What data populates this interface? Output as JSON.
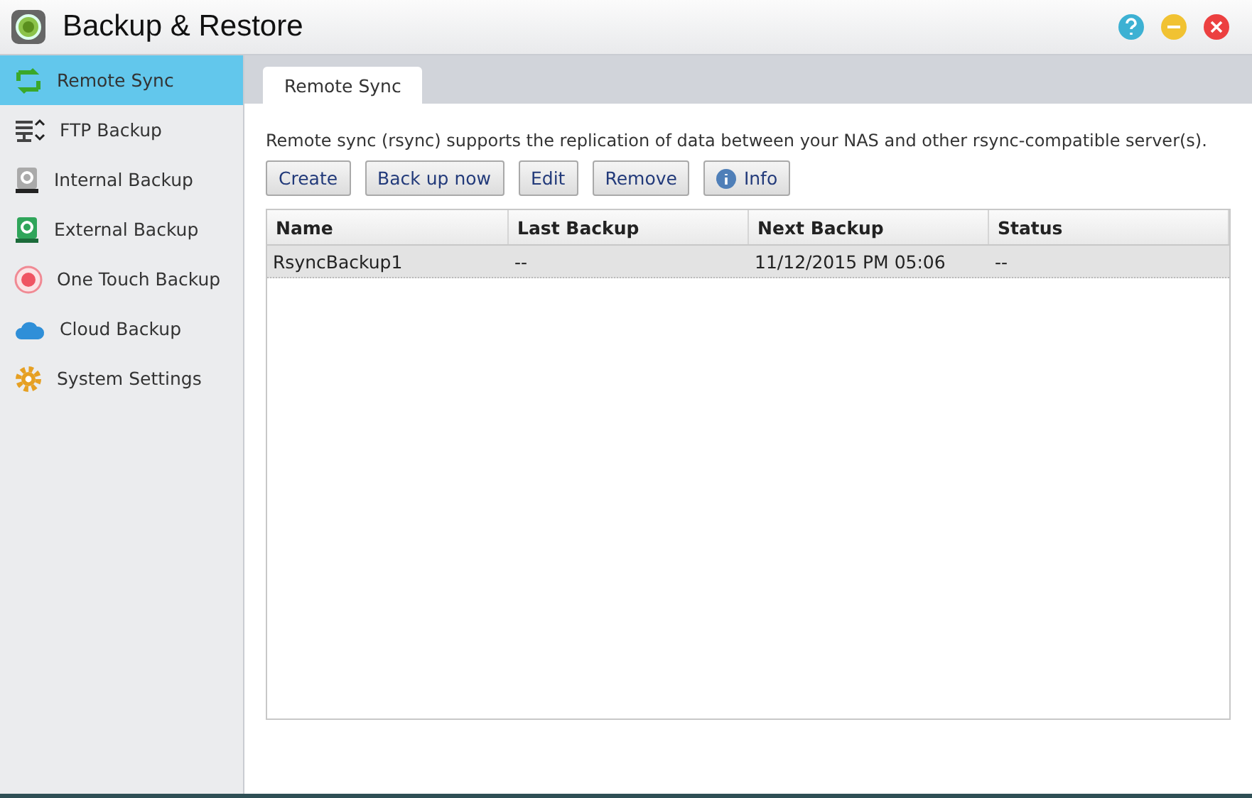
{
  "window": {
    "title": "Backup & Restore"
  },
  "sidebar": {
    "items": [
      {
        "label": "Remote Sync",
        "selected": true
      },
      {
        "label": "FTP Backup",
        "selected": false
      },
      {
        "label": "Internal Backup",
        "selected": false
      },
      {
        "label": "External Backup",
        "selected": false
      },
      {
        "label": "One Touch Backup",
        "selected": false
      },
      {
        "label": "Cloud Backup",
        "selected": false
      },
      {
        "label": "System Settings",
        "selected": false
      }
    ]
  },
  "tabs": [
    {
      "label": "Remote Sync",
      "selected": true
    }
  ],
  "description": "Remote sync (rsync) supports the replication of data between your NAS and other rsync-compatible server(s).",
  "buttons": [
    {
      "label": "Create"
    },
    {
      "label": "Back up now"
    },
    {
      "label": "Edit"
    },
    {
      "label": "Remove"
    },
    {
      "label": "Info",
      "kind": "info"
    }
  ],
  "table": {
    "columns": [
      "Name",
      "Last Backup",
      "Next Backup",
      "Status"
    ],
    "rows": [
      {
        "cells": [
          "RsyncBackup1",
          "--",
          "11/12/2015 PM 05:06",
          "--"
        ],
        "selected": true
      }
    ]
  }
}
